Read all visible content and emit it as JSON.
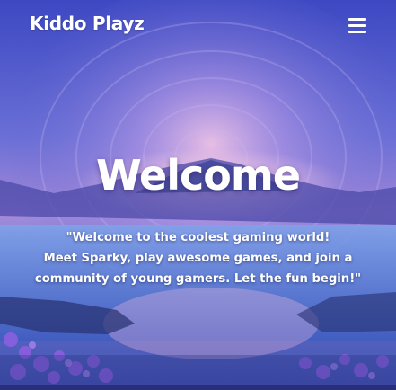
{
  "header": {
    "brand": "Kiddo Playz",
    "menu_icon": "hamburger-menu-icon"
  },
  "hero": {
    "headline": "Welcome",
    "intro_lines": [
      "\"Welcome to the coolest gaming world!",
      "Meet Sparky, play awesome games, and join a",
      "community of young gamers. Let the fun begin!\""
    ]
  },
  "colors": {
    "sky_top": "#4a52c9",
    "sky_mid": "#8a7fd8",
    "glow": "#f0b3d8",
    "water": "#4c6fd0",
    "flowers": "#8f5fe0"
  }
}
